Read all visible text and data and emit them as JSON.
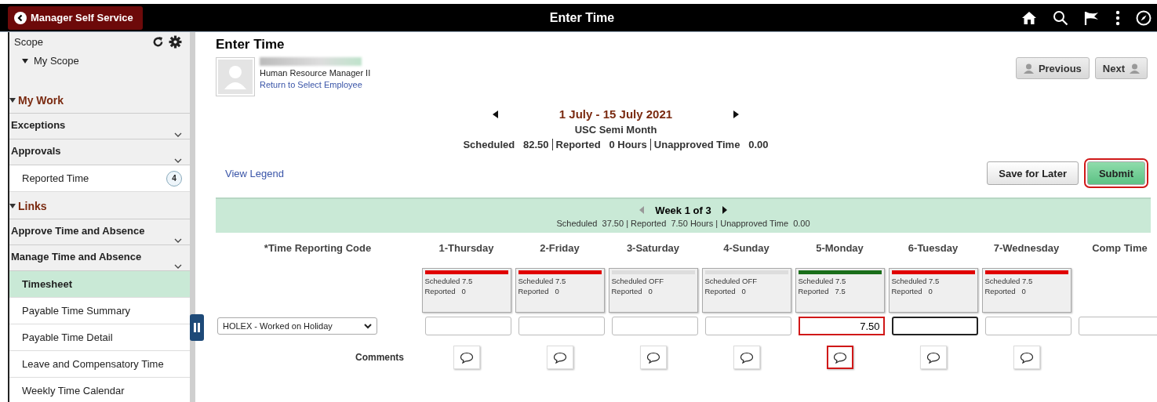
{
  "header": {
    "back_label": "Manager Self Service",
    "title": "Enter Time"
  },
  "sidebar": {
    "scope_title": "Scope",
    "scope_item": "My Scope",
    "sections": [
      {
        "title": "My Work",
        "expanded": true,
        "groups": [
          {
            "label": "Exceptions"
          },
          {
            "label": "Approvals",
            "items": [
              {
                "label": "Reported Time",
                "badge": "4",
                "selected": false
              }
            ]
          }
        ]
      },
      {
        "title": "Links",
        "expanded": true,
        "groups": [
          {
            "label": "Approve Time and Absence"
          },
          {
            "label": "Manage Time and Absence",
            "items": [
              {
                "label": "Timesheet",
                "selected": true
              },
              {
                "label": "Payable Time Summary",
                "selected": false
              },
              {
                "label": "Payable Time Detail",
                "selected": false
              },
              {
                "label": "Leave and Compensatory Time",
                "selected": false
              },
              {
                "label": "Weekly Time Calendar",
                "selected": false
              }
            ]
          }
        ]
      }
    ]
  },
  "page_title": "Enter Time",
  "employee": {
    "job_title": "Human Resource Manager II",
    "link": "Return to Select Employee"
  },
  "nav_buttons": [
    "Previous",
    "Next"
  ],
  "period": {
    "range": "1 July - 15 July 2021",
    "schedule": "USC Semi Month",
    "summary": [
      {
        "label": "Scheduled",
        "value": "82.50"
      },
      {
        "label": "Reported",
        "value": "0 Hours"
      },
      {
        "label": "Unapproved Time",
        "value": "0.00"
      }
    ]
  },
  "legend_link": "View Legend",
  "actions": [
    {
      "label": "Save for Later",
      "kind": "plain",
      "highlighted": false
    },
    {
      "label": "Submit",
      "kind": "primary",
      "highlighted": true
    }
  ],
  "week": {
    "title": "Week 1 of 3",
    "prev_disabled": true,
    "summary": "Scheduled  37.50 | Reported  7.50 Hours | Unapproved Time  0.00"
  },
  "grid": {
    "code_header": "*Time Reporting Code",
    "code_value": "HOLEX - Worked on Holiday",
    "comments_label": "Comments",
    "columns": [
      {
        "kind": "day",
        "label": "1-Thursday",
        "color": "#e00000",
        "scheduled": "Scheduled 7.5",
        "reported_label": "Reported",
        "reported": "0",
        "highlighted": false,
        "focused": false,
        "comment_highlighted": false
      },
      {
        "kind": "day",
        "label": "2-Friday",
        "color": "#e00000",
        "scheduled": "Scheduled 7.5",
        "reported_label": "Reported",
        "reported": "0",
        "highlighted": false,
        "focused": false,
        "comment_highlighted": false
      },
      {
        "kind": "day",
        "label": "3-Saturday",
        "color": "#dddddd",
        "scheduled": "Scheduled OFF",
        "reported_label": "Reported",
        "reported": "0",
        "highlighted": false,
        "focused": false,
        "comment_highlighted": false
      },
      {
        "kind": "day",
        "label": "4-Sunday",
        "color": "#dddddd",
        "scheduled": "Scheduled OFF",
        "reported_label": "Reported",
        "reported": "0",
        "highlighted": false,
        "focused": false,
        "comment_highlighted": false
      },
      {
        "kind": "day",
        "label": "5-Monday",
        "color": "#1a6e1a",
        "scheduled": "Scheduled 7.5",
        "reported_label": "Reported",
        "reported": "7.5",
        "value": "7.50",
        "highlighted": true,
        "focused": false,
        "comment_highlighted": true
      },
      {
        "kind": "day",
        "label": "6-Tuesday",
        "color": "#e00000",
        "scheduled": "Scheduled 7.5",
        "reported_label": "Reported",
        "reported": "0",
        "highlighted": false,
        "focused": true,
        "comment_highlighted": false
      },
      {
        "kind": "day",
        "label": "7-Wednesday",
        "color": "#e00000",
        "scheduled": "Scheduled 7.5",
        "reported_label": "Reported",
        "reported": "0",
        "highlighted": false,
        "focused": false,
        "comment_highlighted": false
      },
      {
        "kind": "comp",
        "label": "Comp Time",
        "highlighted": false,
        "focused": false
      }
    ]
  }
}
